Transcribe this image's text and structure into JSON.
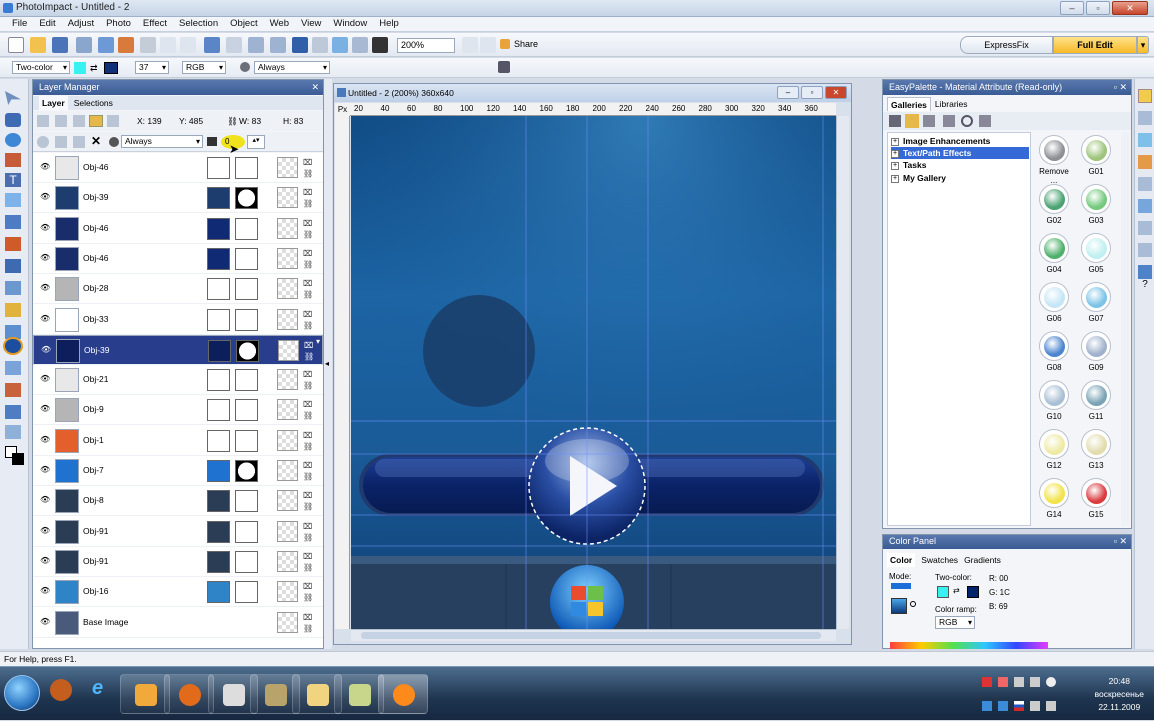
{
  "app": {
    "title": "PhotoImpact - Untitled - 2"
  },
  "menu": [
    "File",
    "Edit",
    "Adjust",
    "Photo",
    "Effect",
    "Selection",
    "Object",
    "Web",
    "View",
    "Window",
    "Help"
  ],
  "toolbar": {
    "zoom": "200%",
    "share_label": "Share",
    "express_label": "ExpressFix",
    "full_edit_label": "Full Edit"
  },
  "attributes": {
    "mode": "Two-color",
    "size": "37",
    "color_model": "RGB",
    "merge": "Always",
    "fg_color": "#38f2f2",
    "bg_color": "#12307a"
  },
  "layer_manager": {
    "title": "Layer Manager",
    "tabs": [
      "Layer",
      "Selections"
    ],
    "info": {
      "x": "X: 139",
      "y": "Y: 485",
      "w": "W: 83",
      "h": "H: 83"
    },
    "merge": "Always",
    "opacity": "0",
    "layers": [
      {
        "name": "Obj-46",
        "selected": false
      },
      {
        "name": "Obj-39",
        "selected": false
      },
      {
        "name": "Obj-46",
        "selected": false
      },
      {
        "name": "Obj-46",
        "selected": false
      },
      {
        "name": "Obj-28",
        "selected": false
      },
      {
        "name": "Obj-33",
        "selected": false
      },
      {
        "name": "Obj-39",
        "selected": true
      },
      {
        "name": "Obj-21",
        "selected": false
      },
      {
        "name": "Obj-9",
        "selected": false
      },
      {
        "name": "Obj-1",
        "selected": false
      },
      {
        "name": "Obj-7",
        "selected": false
      },
      {
        "name": "Obj-8",
        "selected": false
      },
      {
        "name": "Obj-91",
        "selected": false
      },
      {
        "name": "Obj-91",
        "selected": false
      },
      {
        "name": "Obj-16",
        "selected": false
      },
      {
        "name": "Base Image",
        "selected": false
      }
    ]
  },
  "document": {
    "title": "Untitled - 2 (200%) 360x640",
    "ruler_unit": "Px",
    "ruler_ticks": [
      "20",
      "40",
      "60",
      "80",
      "100",
      "120",
      "140",
      "160",
      "180",
      "200",
      "220",
      "240",
      "260",
      "280",
      "300",
      "320",
      "340",
      "360"
    ]
  },
  "easy_palette": {
    "title": "EasyPalette - Material Attribute (Read-only)",
    "tabs": [
      "Galleries",
      "Libraries"
    ],
    "tree": [
      {
        "label": "Image Enhancements",
        "highlight": false
      },
      {
        "label": "Text/Path Effects",
        "highlight": true
      },
      {
        "label": "Tasks",
        "highlight": false
      },
      {
        "label": "My Gallery",
        "highlight": false
      }
    ],
    "gallery": [
      {
        "label": "Remove ...",
        "color": "#8d8f94"
      },
      {
        "label": "G01",
        "color": "#9dc47a"
      },
      {
        "label": "G02",
        "color": "#4ba373"
      },
      {
        "label": "G03",
        "color": "#74c97c"
      },
      {
        "label": "G04",
        "color": "#4fb06b"
      },
      {
        "label": "G05",
        "color": "#bfeff0"
      },
      {
        "label": "G06",
        "color": "#c5e6f7"
      },
      {
        "label": "G07",
        "color": "#7cc3e6"
      },
      {
        "label": "G08",
        "color": "#4d86cf"
      },
      {
        "label": "G09",
        "color": "#9fb1cc"
      },
      {
        "label": "G10",
        "color": "#a9bfd4"
      },
      {
        "label": "G11",
        "color": "#7aa3b5"
      },
      {
        "label": "G12",
        "color": "#eeeaa4"
      },
      {
        "label": "G13",
        "color": "#e2dcae"
      },
      {
        "label": "G14",
        "color": "#f2e34a"
      },
      {
        "label": "G15",
        "color": "#d93b3f"
      }
    ]
  },
  "color_panel": {
    "title": "Color Panel",
    "tabs": [
      "Color",
      "Swatches",
      "Gradients"
    ],
    "mode_label": "Mode:",
    "two_color_label": "Two-color:",
    "ramp_label": "Color ramp:",
    "ramp_model": "RGB",
    "r": "R: 00",
    "g": "G: 1C",
    "b": "B: 69"
  },
  "status": {
    "text": "For Help, press F1."
  },
  "taskbar": {
    "time": "20:48",
    "day": "воскресенье",
    "date": "22.11.2009"
  }
}
